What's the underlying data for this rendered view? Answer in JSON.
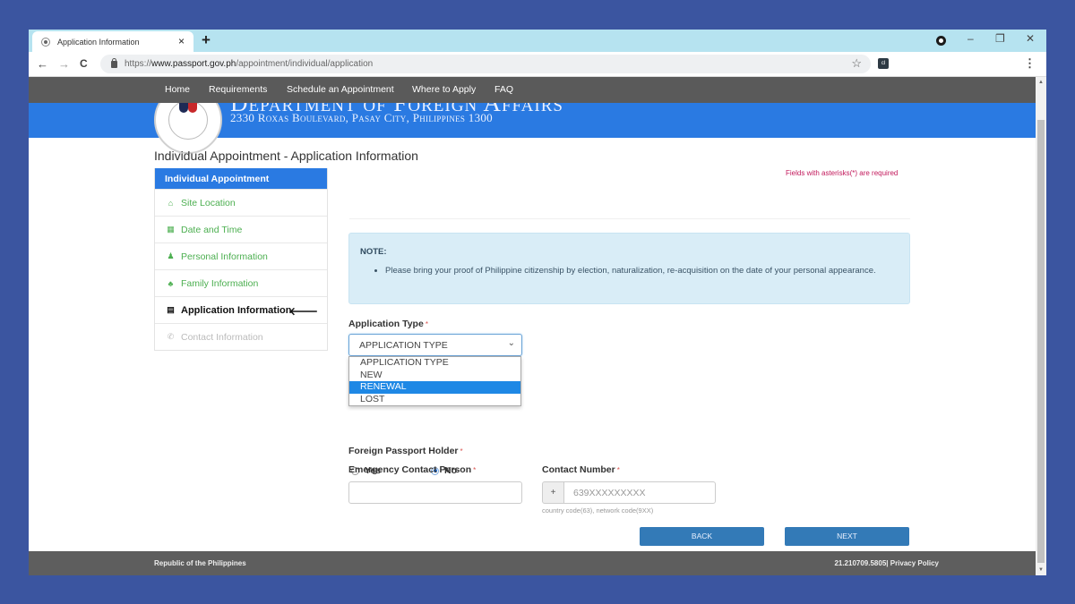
{
  "browser": {
    "tab_title": "Application Information",
    "tab_close": "×",
    "new_tab": "+",
    "url_prefix": "https://",
    "url_domain": "www.passport.gov.ph",
    "url_path": "/appointment/individual/application",
    "controls": {
      "minimize": "–",
      "maximize": "❐",
      "close": "✕"
    },
    "nav": {
      "back": "←",
      "forward": "→",
      "reload": "C"
    },
    "star": "☆",
    "extension": "cl",
    "menu": "⋮"
  },
  "header": {
    "nav_items": [
      "Home",
      "Requirements",
      "Schedule an Appointment",
      "Where to Apply",
      "FAQ"
    ],
    "dept_title": "Department of Foreign Affairs",
    "dept_address": "2330 Roxas Boulevard, Pasay City, Philippines 1300"
  },
  "page": {
    "title": "Individual Appointment - Application Information",
    "required_note": "Fields with asterisks(*) are required"
  },
  "sidebar": {
    "heading": "Individual Appointment",
    "items": [
      {
        "label": "Site Location",
        "icon": "home-icon",
        "glyph": "⌂",
        "state": "done"
      },
      {
        "label": "Date and Time",
        "icon": "calendar-icon",
        "glyph": "▦",
        "state": "done"
      },
      {
        "label": "Personal Information",
        "icon": "user-icon",
        "glyph": "♟",
        "state": "done"
      },
      {
        "label": "Family Information",
        "icon": "users-icon",
        "glyph": "♣",
        "state": "done"
      },
      {
        "label": "Application Information",
        "icon": "card-icon",
        "glyph": "▤",
        "state": "active"
      },
      {
        "label": "Contact Information",
        "icon": "phone-icon",
        "glyph": "✆",
        "state": "disabled"
      }
    ],
    "active_arrow": "🡐"
  },
  "note": {
    "title": "NOTE:",
    "items": [
      "Please bring your proof of Philippine citizenship by election, naturalization, re-acquisition on the date of your personal appearance."
    ]
  },
  "form": {
    "application_type": {
      "label": "Application Type",
      "required": "*",
      "selected": "APPLICATION TYPE",
      "options": [
        "APPLICATION TYPE",
        "NEW",
        "RENEWAL",
        "LOST"
      ],
      "highlighted": "RENEWAL"
    },
    "foreign_passport": {
      "label": "Foreign Passport Holder",
      "required": "*",
      "options": [
        "Yes",
        "No"
      ],
      "selected": "No"
    },
    "emergency_contact": {
      "label": "Emergency Contact Person",
      "required": "*",
      "value": "",
      "placeholder": ""
    },
    "contact_number": {
      "label": "Contact Number",
      "required": "*",
      "prefix": "+",
      "placeholder": "639XXXXXXXXX",
      "help": "country code(63), network code(9XX)"
    },
    "back_label": "BACK",
    "next_label": "NEXT"
  },
  "footer": {
    "left": "Republic of the Philippines",
    "right": "21.210709.5805| Privacy Policy"
  },
  "colors": {
    "outer_bg": "#3b55a0",
    "brand_blue": "#2a7ae2",
    "nav_gray": "#5a5a5a",
    "step_done": "#4caf50",
    "button": "#337ab7",
    "required": "#c2185b",
    "note_bg": "#d9edf7"
  }
}
